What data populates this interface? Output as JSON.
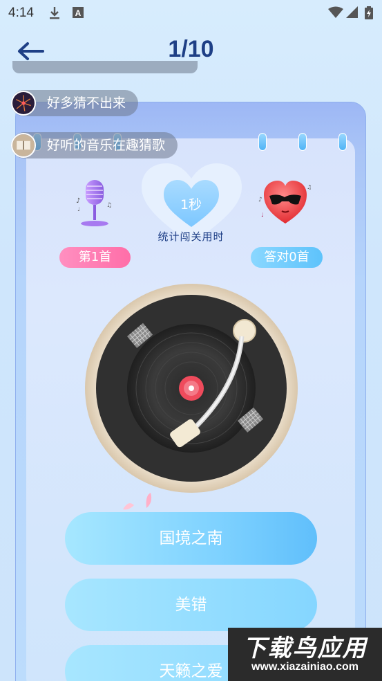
{
  "status_bar": {
    "time": "4:14",
    "icons": [
      "download-icon",
      "text-a-icon",
      "wifi-icon",
      "signal-icon",
      "battery-charging-icon"
    ]
  },
  "header": {
    "title": "1/10",
    "back_icon": "back-arrow-icon"
  },
  "danmaku": [
    {
      "text": "好多猜不出来",
      "avatar": "fireworks-avatar"
    },
    {
      "text": "好听的音乐在趣猜歌",
      "avatar": "book-avatar"
    }
  ],
  "stats": {
    "timer_value": "1秒",
    "timer_label": "统计闯关用时",
    "current_song": "第1首",
    "correct_count": "答对0首"
  },
  "options": [
    "国境之南",
    "美错",
    "天籁之爱"
  ],
  "watermark": {
    "big": "下载鸟应用",
    "small": "www.xiazainiao.com"
  },
  "colors": {
    "title": "#1e3f86",
    "pink_pill": "#ff7fb2",
    "blue_pill": "#6ec8fc",
    "option": "#7fd2ff"
  }
}
